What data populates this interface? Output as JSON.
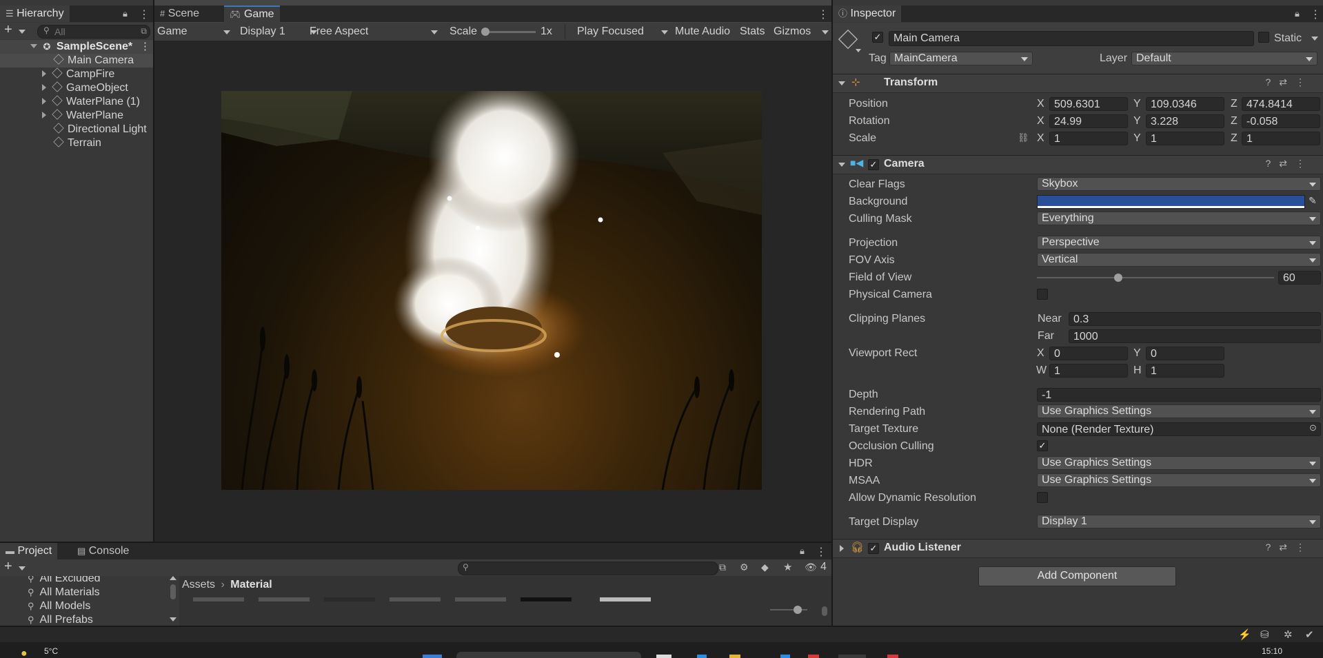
{
  "hierarchy": {
    "tab_label": "Hierarchy",
    "search_placeholder": "All",
    "scene_name": "SampleScene*",
    "items": [
      {
        "label": "Main Camera"
      },
      {
        "label": "CampFire"
      },
      {
        "label": "GameObject"
      },
      {
        "label": "WaterPlane (1)"
      },
      {
        "label": "WaterPlane"
      },
      {
        "label": "Directional Light"
      },
      {
        "label": "Terrain"
      }
    ]
  },
  "center": {
    "tabs": [
      {
        "label": "Scene"
      },
      {
        "label": "Game"
      }
    ],
    "toolbar": {
      "view": "Game",
      "display": "Display 1",
      "aspect": "Free Aspect",
      "scale_label": "Scale",
      "scale_value": "1x",
      "play_mode": "Play Focused",
      "mute": "Mute Audio",
      "stats": "Stats",
      "gizmos": "Gizmos"
    }
  },
  "inspector": {
    "tab_label": "Inspector",
    "object_name": "Main Camera",
    "static_label": "Static",
    "tag_label": "Tag",
    "tag_value": "MainCamera",
    "layer_label": "Layer",
    "layer_value": "Default",
    "transform": {
      "title": "Transform",
      "rows": [
        {
          "label": "Position",
          "x": "509.6301",
          "y": "109.0346",
          "z": "474.8414"
        },
        {
          "label": "Rotation",
          "x": "24.99",
          "y": "3.228",
          "z": "-0.058"
        },
        {
          "label": "Scale",
          "x": "1",
          "y": "1",
          "z": "1"
        }
      ]
    },
    "camera": {
      "title": "Camera",
      "clear_flags": {
        "label": "Clear Flags",
        "value": "Skybox"
      },
      "background": {
        "label": "Background",
        "color": "#2a4f9a"
      },
      "culling_mask": {
        "label": "Culling Mask",
        "value": "Everything"
      },
      "projection": {
        "label": "Projection",
        "value": "Perspective"
      },
      "fov_axis": {
        "label": "FOV Axis",
        "value": "Vertical"
      },
      "fov": {
        "label": "Field of View",
        "value": "60",
        "slider_fraction": 0.34
      },
      "physical": {
        "label": "Physical Camera"
      },
      "clipping": {
        "label": "Clipping Planes",
        "near_label": "Near",
        "near": "0.3",
        "far_label": "Far",
        "far": "1000"
      },
      "viewport": {
        "label": "Viewport Rect",
        "x": "0",
        "y": "0",
        "w": "1",
        "h": "1"
      },
      "depth": {
        "label": "Depth",
        "value": "-1"
      },
      "rendering_path": {
        "label": "Rendering Path",
        "value": "Use Graphics Settings"
      },
      "target_texture": {
        "label": "Target Texture",
        "value": "None (Render Texture)"
      },
      "occlusion": {
        "label": "Occlusion Culling"
      },
      "hdr": {
        "label": "HDR",
        "value": "Use Graphics Settings"
      },
      "msaa": {
        "label": "MSAA",
        "value": "Use Graphics Settings"
      },
      "dynamic_res": {
        "label": "Allow Dynamic Resolution"
      },
      "target_display": {
        "label": "Target Display",
        "value": "Display 1"
      }
    },
    "audio_listener": {
      "title": "Audio Listener"
    },
    "add_component": "Add Component"
  },
  "project": {
    "tabs": [
      {
        "label": "Project"
      },
      {
        "label": "Console"
      }
    ],
    "tree": [
      {
        "label": "All Excluded"
      },
      {
        "label": "All Materials"
      },
      {
        "label": "All Models"
      },
      {
        "label": "All Prefabs"
      }
    ],
    "breadcrumb": {
      "root": "Assets",
      "current": "Material"
    },
    "hidden_count": "4"
  },
  "taskbar": {
    "weather": "5°C",
    "time": "15:10"
  }
}
